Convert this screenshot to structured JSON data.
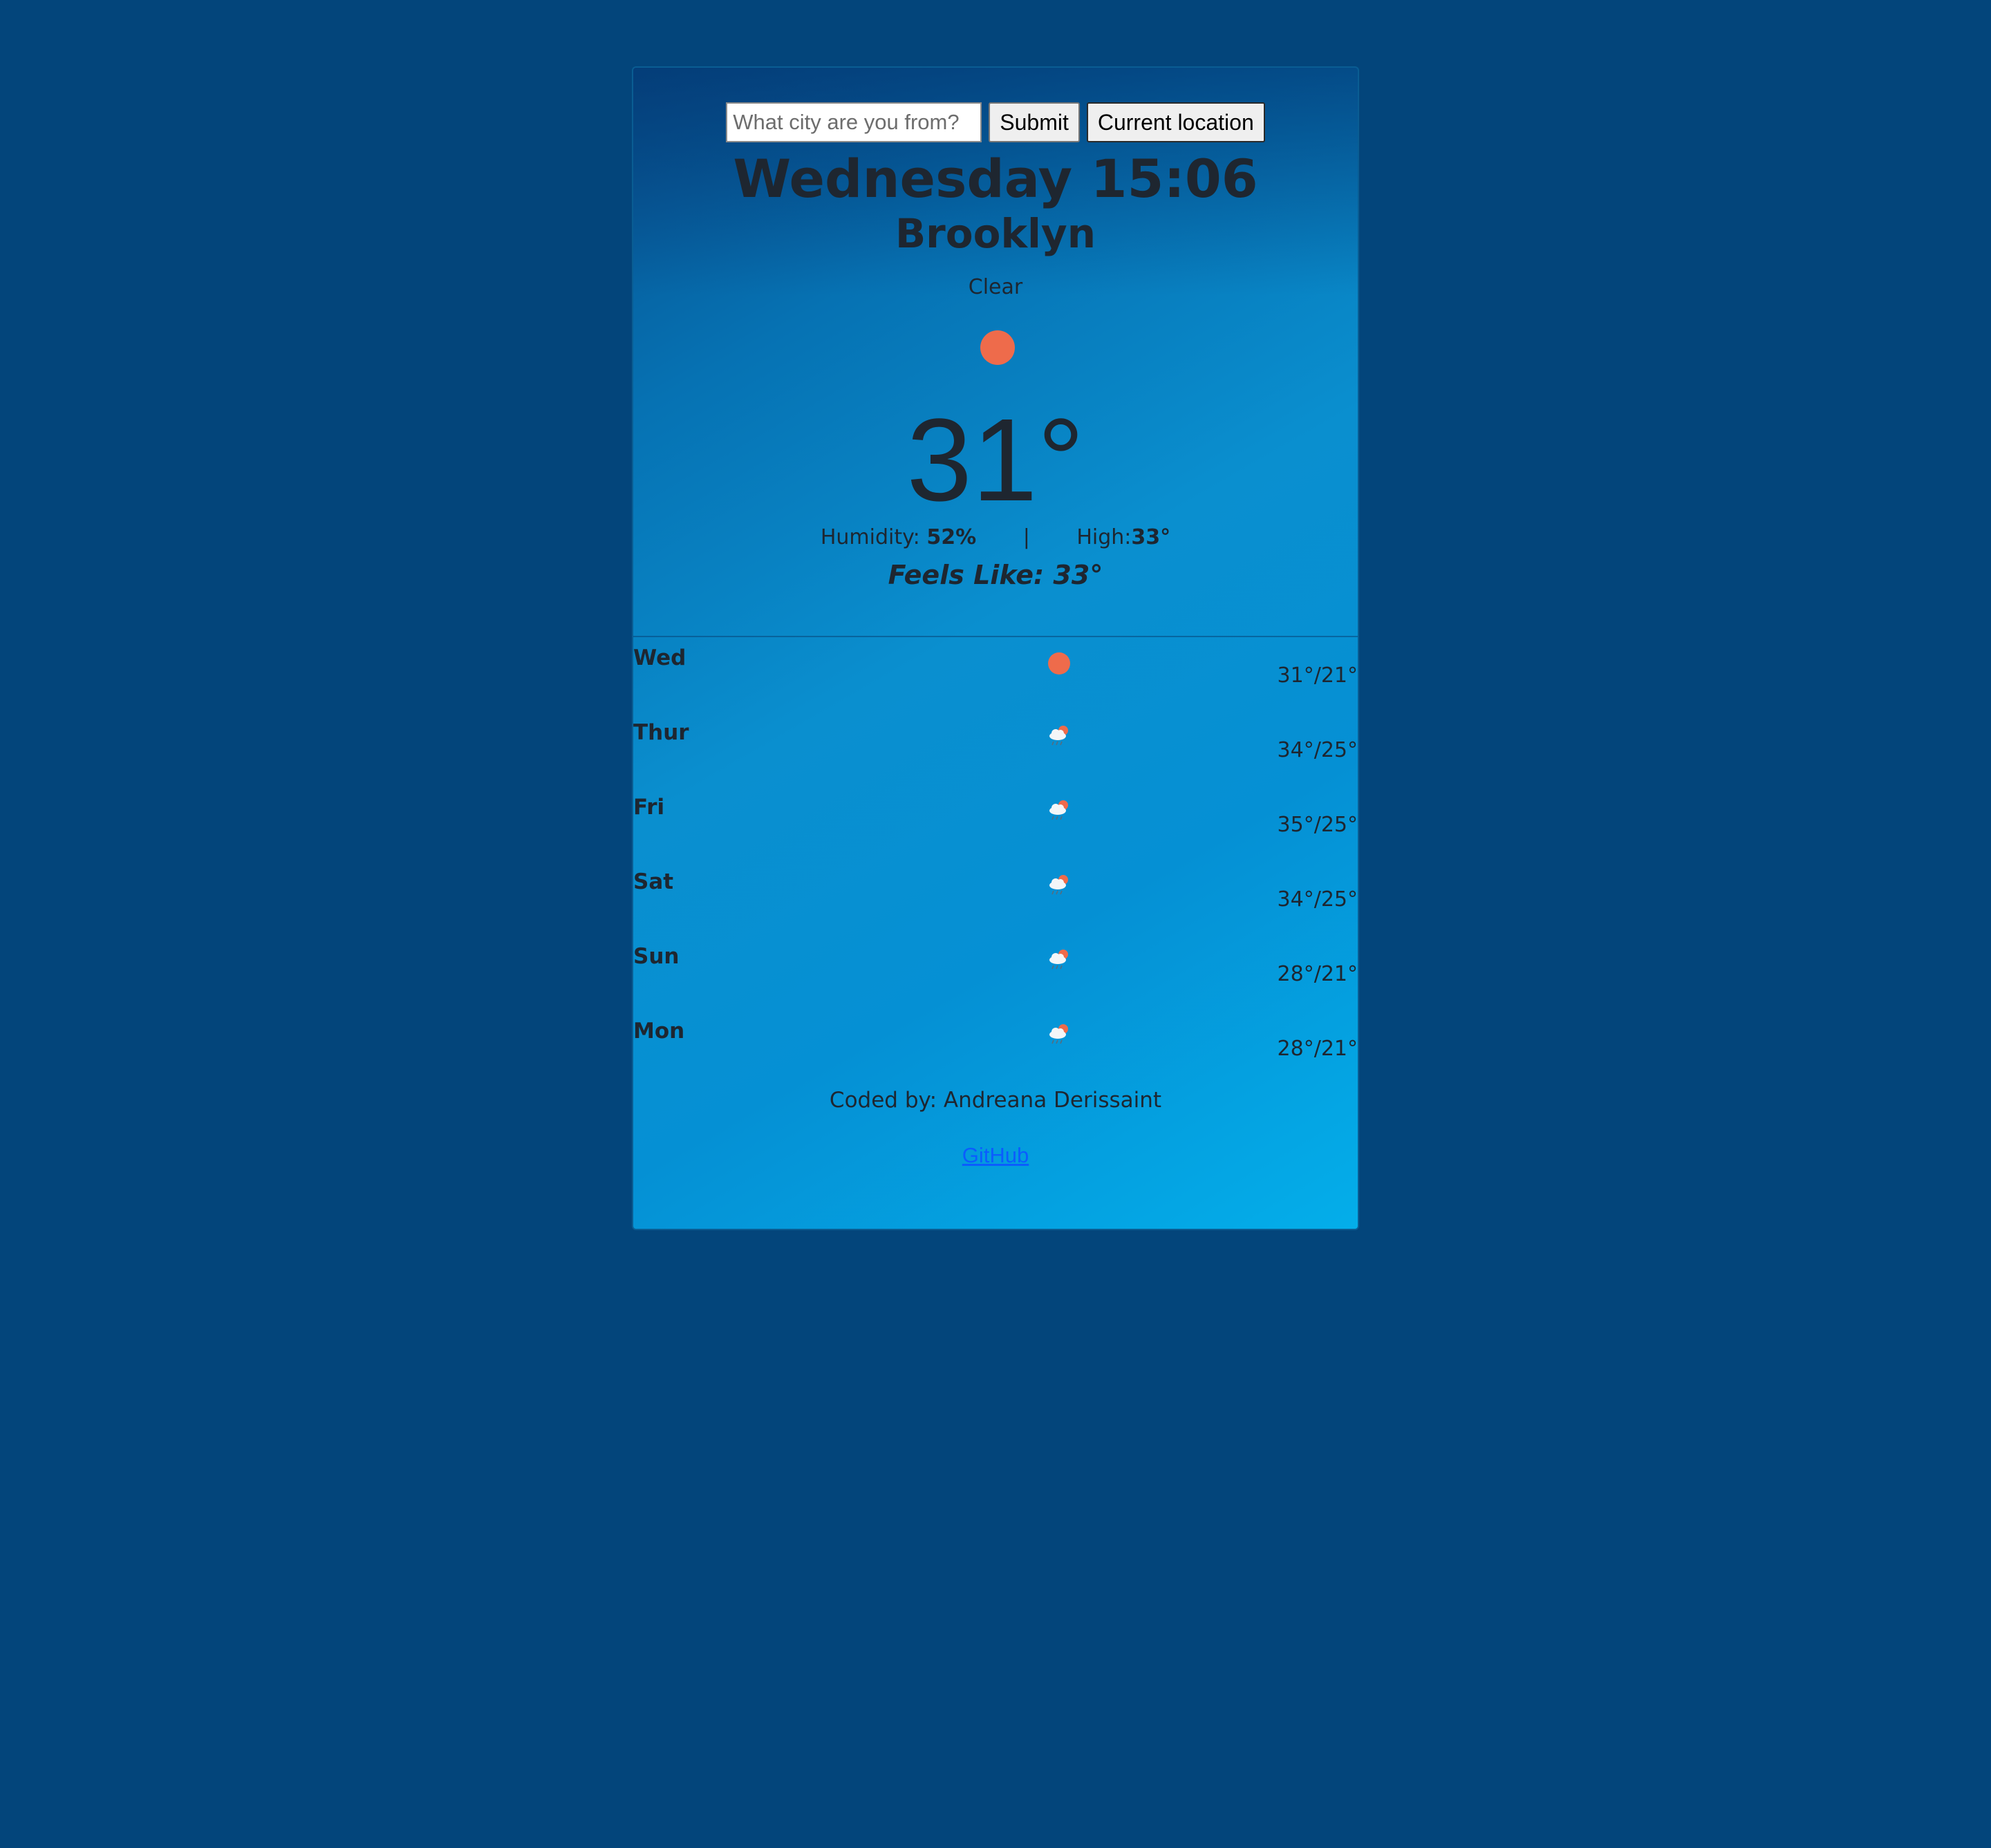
{
  "search": {
    "placeholder": "What city are you from?",
    "submit_label": "Submit",
    "current_location_label": "Current location"
  },
  "current": {
    "day_time": "Wednesday 15:06",
    "city": "Brooklyn",
    "description": "Clear",
    "icon": "sun-icon",
    "temperature": "31°",
    "humidity_label": "Humidity:",
    "humidity_value": "52%",
    "separator": "|",
    "high_label": "High:",
    "high_value": "33°",
    "feels_like": "Feels Like: 33°"
  },
  "forecast": [
    {
      "day": "Wed",
      "icon": "sun-icon",
      "temps": "31°/21°"
    },
    {
      "day": "Thur",
      "icon": "cloud-sun-rain-icon",
      "temps": "34°/25°"
    },
    {
      "day": "Fri",
      "icon": "cloud-sun-rain-icon",
      "temps": "35°/25°"
    },
    {
      "day": "Sat",
      "icon": "cloud-sun-rain-icon",
      "temps": "34°/25°"
    },
    {
      "day": "Sun",
      "icon": "cloud-sun-rain-icon",
      "temps": "28°/21°"
    },
    {
      "day": "Mon",
      "icon": "cloud-sun-rain-icon",
      "temps": "28°/21°"
    }
  ],
  "footer": {
    "coded_by": "Coded by: Andreana Derissaint",
    "github_label": "GitHub"
  },
  "colors": {
    "page_background": "#03457b",
    "sun": "#ee6b4b",
    "link": "#0b5dff",
    "text": "#1e2630"
  }
}
